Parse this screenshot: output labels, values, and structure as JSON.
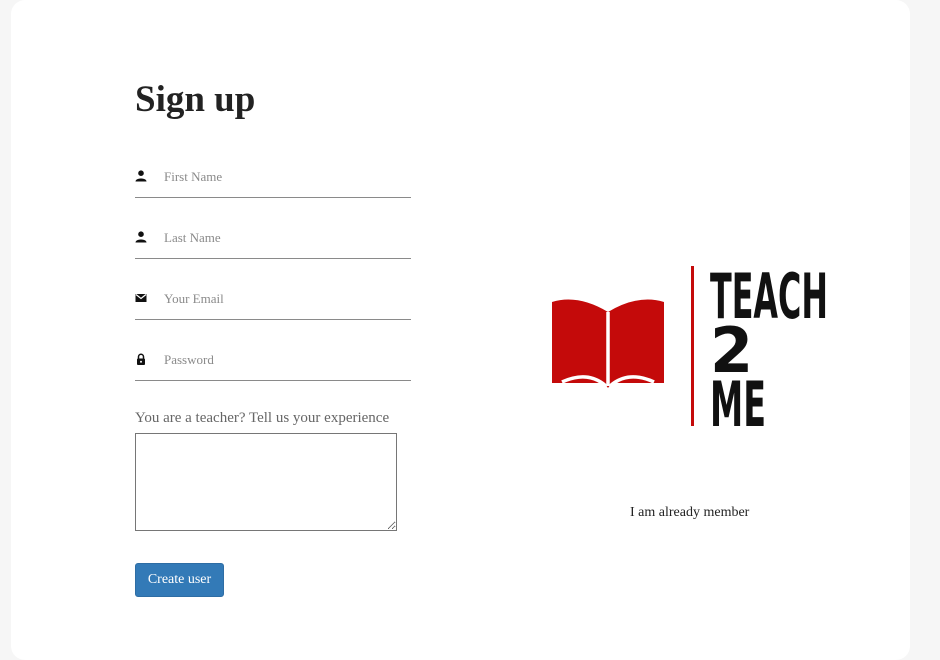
{
  "form": {
    "title": "Sign up",
    "first_name_placeholder": "First Name",
    "last_name_placeholder": "Last Name",
    "email_placeholder": "Your Email",
    "password_placeholder": "Password",
    "experience_label": "You are a teacher? Tell us your experience",
    "experience_value": "",
    "submit_label": "Create user"
  },
  "logo": {
    "lines": [
      "TEACH",
      "2",
      "ME"
    ],
    "book_color": "#c40a0a",
    "divider_color": "#c40a0a"
  },
  "member_link_label": "I am already member",
  "colors": {
    "primary_button": "#337ab7",
    "title_text": "#222222"
  }
}
